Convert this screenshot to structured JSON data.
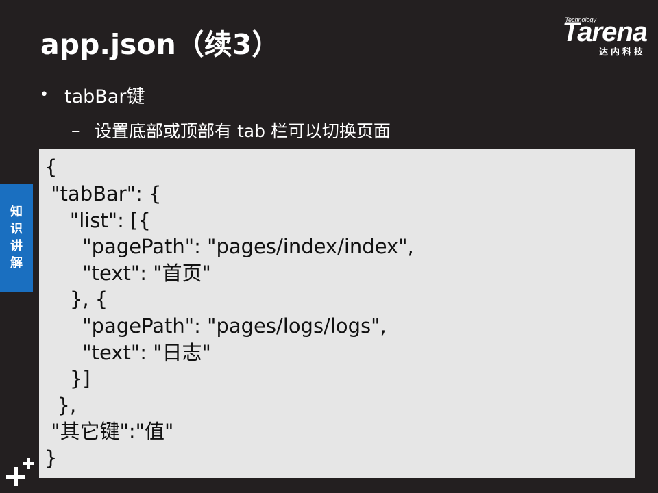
{
  "slide": {
    "title": "app.json（续3）"
  },
  "logo": {
    "tech": "Technology",
    "word": "Tarena",
    "cn": "达内科技"
  },
  "bullet": {
    "symbol": "•",
    "text": "tabBar键"
  },
  "subbullet": {
    "symbol": "–",
    "text": "设置底部或顶部有 tab 栏可以切换页面"
  },
  "code": {
    "lines": [
      "{",
      " \"tabBar\": {",
      "    \"list\": [{",
      "      \"pagePath\": \"pages/index/index\",",
      "      \"text\": \"首页\"",
      "    }, {",
      "      \"pagePath\": \"pages/logs/logs\",",
      "      \"text\": \"日志\"",
      "    }]",
      "  },",
      " \"其它键\":\"值\"",
      "}"
    ]
  },
  "side_tab": {
    "chars": [
      "知",
      "识",
      "讲",
      "解"
    ]
  },
  "colors": {
    "background": "#231f20",
    "code_background": "#e6e6e6",
    "side_tab": "#1a6fc0"
  },
  "icons": {
    "corner": "plus-plus-icon"
  }
}
